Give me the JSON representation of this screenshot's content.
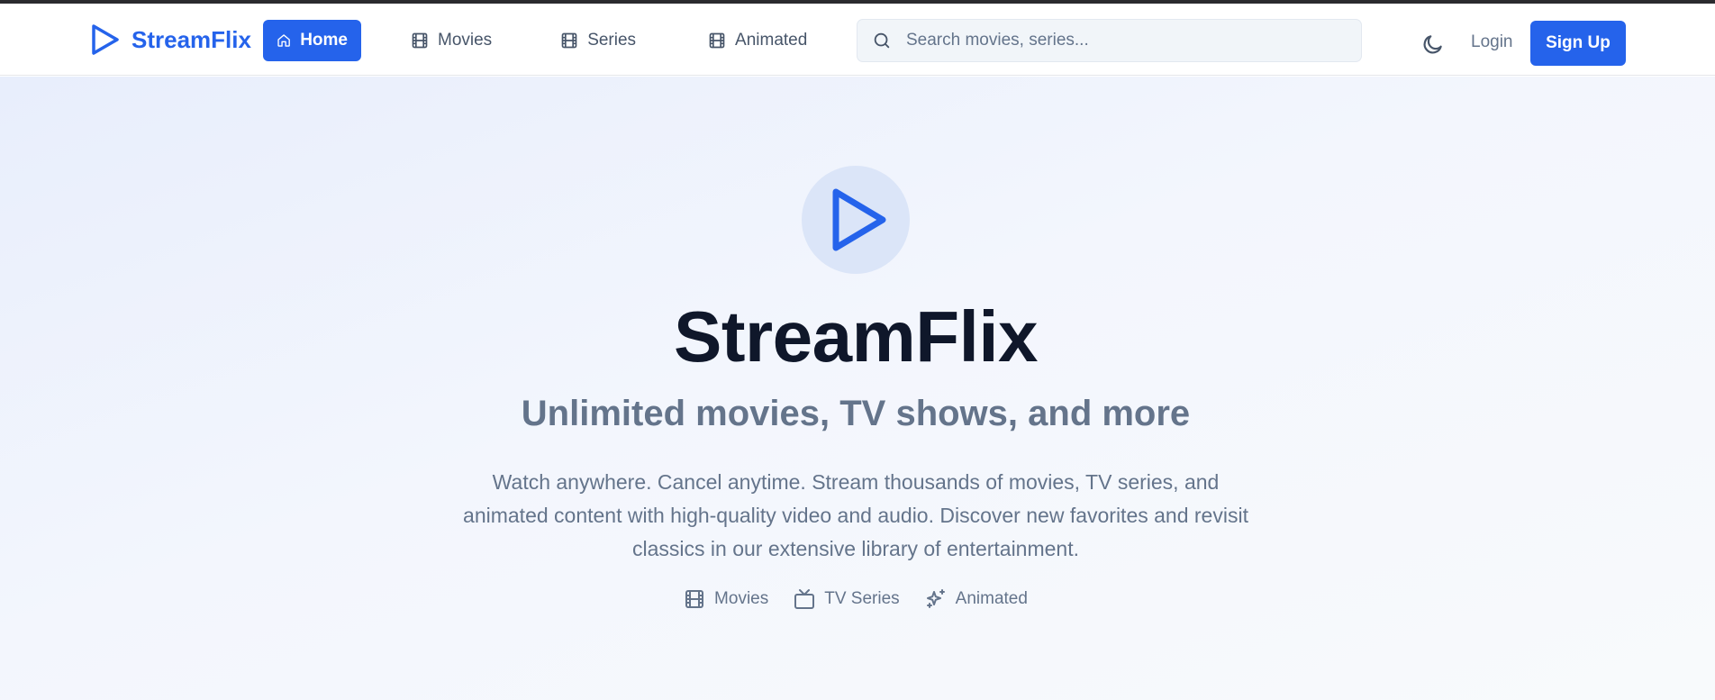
{
  "app": {
    "brand": "StreamFlix",
    "colors": {
      "accent": "#2563eb",
      "heading": "#0f172a",
      "muted": "#64748b"
    }
  },
  "header": {
    "logo_icon": "play-icon",
    "nav": [
      {
        "label": "Home",
        "icon": "home-icon",
        "active": true
      },
      {
        "label": "Movies",
        "icon": "film-icon",
        "active": false
      },
      {
        "label": "Series",
        "icon": "film-icon",
        "active": false
      },
      {
        "label": "Animated",
        "icon": "film-icon",
        "active": false
      }
    ],
    "search": {
      "placeholder": "Search movies, series...",
      "value": "",
      "icon": "search-icon"
    },
    "theme_icon": "moon-icon",
    "login_label": "Login",
    "signup_label": "Sign Up"
  },
  "hero": {
    "icon": "play-icon",
    "title": "StreamFlix",
    "subtitle": "Unlimited movies, TV shows, and more",
    "description": "Watch anywhere. Cancel anytime. Stream thousands of movies, TV series, and animated content with high-quality video and audio. Discover new favorites and revisit classics in our extensive library of entertainment.",
    "categories": [
      {
        "label": "Movies",
        "icon": "film-icon"
      },
      {
        "label": "TV Series",
        "icon": "tv-icon"
      },
      {
        "label": "Animated",
        "icon": "sparkles-icon"
      }
    ]
  }
}
